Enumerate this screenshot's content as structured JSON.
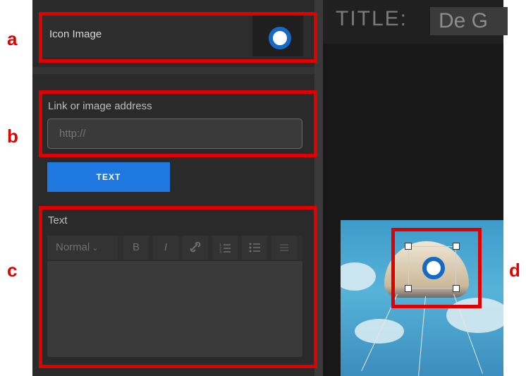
{
  "callouts": {
    "a": "a",
    "b": "b",
    "c": "c",
    "d": "d"
  },
  "icon_image": {
    "label": "Icon Image"
  },
  "link": {
    "label": "Link or image address",
    "placeholder": "http://"
  },
  "text_button": {
    "label": "TEXT"
  },
  "text_section": {
    "label": "Text",
    "toolbar": {
      "style_select": "Normal",
      "bold": "B",
      "italic": "I",
      "link_icon": "link-icon",
      "ordered_list_icon": "ordered-list-icon",
      "bullet_list_icon": "bullet-list-icon",
      "align_icon": "align-icon"
    }
  },
  "editor": {
    "title_label": "TITLE:",
    "title_value": "De G"
  },
  "colors": {
    "accent_blue": "#1f78e0",
    "highlight_red": "#e00000",
    "icon_ring": "#1569c7"
  }
}
